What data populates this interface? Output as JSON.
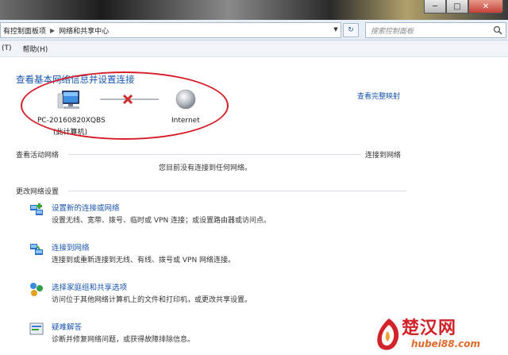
{
  "window": {
    "buttons": [
      "─",
      "□",
      "✕"
    ]
  },
  "address": {
    "crumbs": [
      "有控制面板项",
      "网络和共享中心"
    ],
    "search_placeholder": "搜索控制面板"
  },
  "menu": {
    "items": [
      "(T)",
      "帮助(H)"
    ]
  },
  "main": {
    "title": "查看基本网络信息并设置连接",
    "full_map_link": "查看完整映射",
    "pc_name": "PC-20160820XQBS",
    "pc_sub": "(此计算机)",
    "internet_label": "Internet",
    "active_networks_label": "查看活动网络",
    "connect_link": "连接到网络",
    "no_connection_text": "您目前没有连接到任何网络。",
    "change_settings_label": "更改网络设置",
    "tasks": [
      {
        "title": "设置新的连接或网络",
        "desc": "设置无线、宽带、拨号、临时或 VPN 连接；或设置路由器或访问点。",
        "icon": "new-connection-icon"
      },
      {
        "title": "连接到网络",
        "desc": "连接到或重新连接到无线、有线、拨号或 VPN 网络连接。",
        "icon": "connect-network-icon"
      },
      {
        "title": "选择家庭组和共享选项",
        "desc": "访问位于其他网络计算机上的文件和打印机，或更改共享设置。",
        "icon": "homegroup-icon"
      },
      {
        "title": "疑难解答",
        "desc": "诊断并修复网络问题，或获得故障排除信息。",
        "icon": "troubleshoot-icon"
      }
    ]
  },
  "watermark": {
    "name": "楚汉网",
    "url": "hubei88.com"
  },
  "colors": {
    "link": "#1a56b0",
    "highlight_ellipse": "#d61f2b",
    "watermark": "#d1232a"
  }
}
